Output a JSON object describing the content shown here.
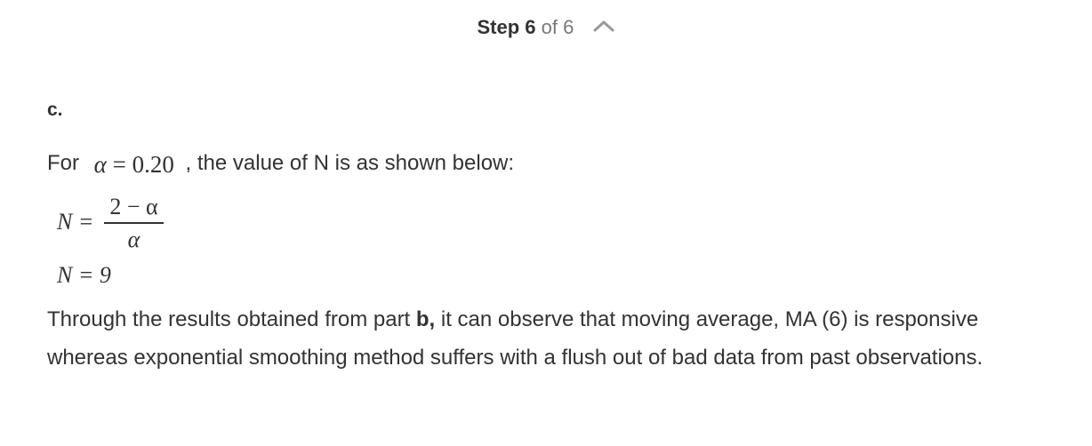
{
  "step": {
    "label": "Step",
    "current": "6",
    "of": "of",
    "total": "6",
    "chevron_icon": "chevron-up-icon"
  },
  "part": {
    "label": "c."
  },
  "intro": {
    "prefix": "For",
    "math_symbol": "α",
    "math_equals": "= 0.20",
    "suffix": ", the value of N is as shown below:"
  },
  "equation1": {
    "lhs": "N =",
    "numerator": "2 − α",
    "denominator": "α"
  },
  "equation2": {
    "text": "N = 9"
  },
  "conclusion": {
    "part1": "Through the results obtained from part ",
    "bold": "b,",
    "part2": " it can observe that moving average, MA (6) is responsive whereas exponential smoothing method suffers with a flush out of bad data from past observations."
  },
  "colors": {
    "text": "#333333",
    "muted": "#777777",
    "chevron": "#999999"
  }
}
